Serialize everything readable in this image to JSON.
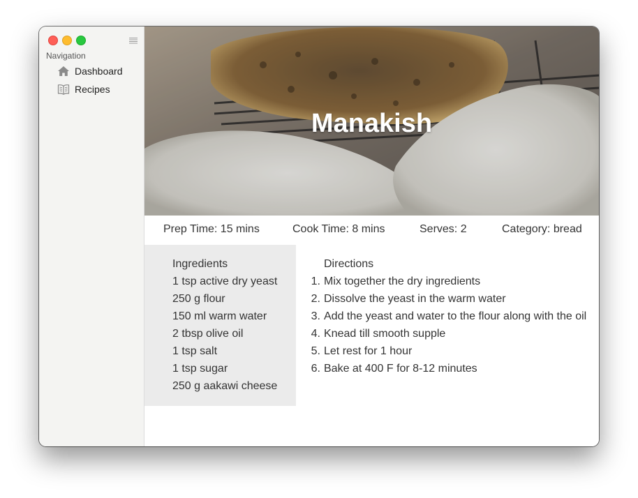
{
  "sidebar": {
    "header": "Navigation",
    "items": [
      {
        "label": "Dashboard",
        "icon": "house-icon"
      },
      {
        "label": "Recipes",
        "icon": "book-icon"
      }
    ]
  },
  "recipe": {
    "title": "Manakish",
    "meta": {
      "prep": "Prep Time: 15 mins",
      "cook": "Cook Time: 8 mins",
      "serves": "Serves: 2",
      "category": "Category: bread"
    },
    "ingredients_title": "Ingredients",
    "ingredients": [
      "1 tsp active dry yeast",
      "250 g flour",
      "150 ml warm water",
      "2 tbsp olive oil",
      "1 tsp salt",
      "1 tsp sugar",
      "250 g aakawi cheese"
    ],
    "directions_title": "Directions",
    "directions": [
      {
        "num": "1.",
        "text": "Mix together the dry ingredients"
      },
      {
        "num": "2.",
        "text": "Dissolve the yeast in the warm water"
      },
      {
        "num": "3.",
        "text": "Add the yeast and water to the flour along with the oil"
      },
      {
        "num": "4.",
        "text": "Knead till smooth supple"
      },
      {
        "num": "5.",
        "text": "Let rest for 1 hour"
      },
      {
        "num": "6.",
        "text": "Bake at 400 F for 8-12 minutes"
      }
    ]
  },
  "colors": {
    "sidebar_bg": "#f4f4f2",
    "ingredients_bg": "#ebebeb",
    "text": "#333333",
    "traffic_close": "#fe5f57",
    "traffic_min": "#febc2e",
    "traffic_max": "#28c840"
  }
}
